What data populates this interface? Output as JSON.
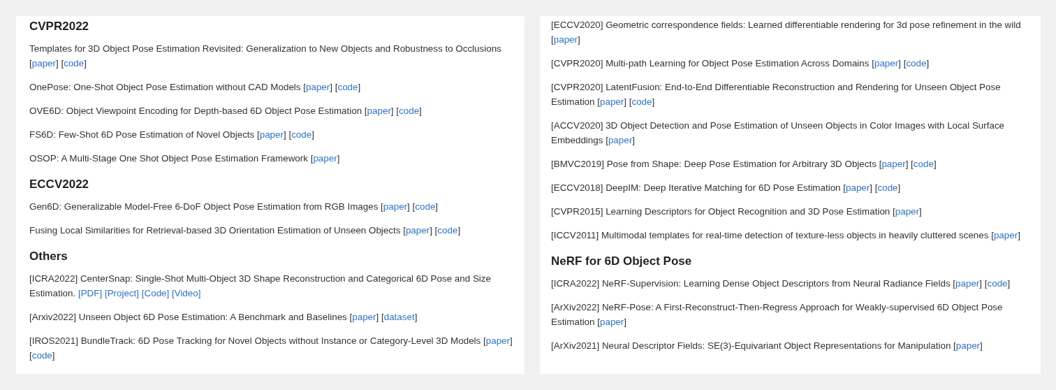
{
  "panels": [
    {
      "blocks": [
        {
          "kind": "heading",
          "text": "CVPR2022"
        },
        {
          "kind": "entry",
          "text": "Templates for 3D Object Pose Estimation Revisited: Generalization to New Objects and Robustness to Occlusions",
          "links": [
            {
              "open": "[",
              "label": "paper",
              "close": "]"
            },
            {
              "open": "[",
              "label": "code",
              "close": "]"
            }
          ]
        },
        {
          "kind": "entry",
          "text": "OnePose: One-Shot Object Pose Estimation without CAD Models",
          "links": [
            {
              "open": "[",
              "label": "paper",
              "close": "]"
            },
            {
              "open": "[",
              "label": "code",
              "close": "]"
            }
          ]
        },
        {
          "kind": "entry",
          "text": "OVE6D: Object Viewpoint Encoding for Depth-based 6D Object Pose Estimation",
          "links": [
            {
              "open": "[",
              "label": "paper",
              "close": "]"
            },
            {
              "open": "[",
              "label": "code",
              "close": "]"
            }
          ]
        },
        {
          "kind": "entry",
          "text": "FS6D: Few-Shot 6D Pose Estimation of Novel Objects",
          "links": [
            {
              "open": "[",
              "label": "paper",
              "close": "]"
            },
            {
              "open": "[",
              "label": "code",
              "close": "]"
            }
          ]
        },
        {
          "kind": "entry",
          "text": "OSOP: A Multi-Stage One Shot Object Pose Estimation Framework",
          "links": [
            {
              "open": "[",
              "label": "paper",
              "close": "]"
            }
          ]
        },
        {
          "kind": "heading",
          "text": "ECCV2022"
        },
        {
          "kind": "entry",
          "text": "Gen6D: Generalizable Model-Free 6-DoF Object Pose Estimation from RGB Images",
          "links": [
            {
              "open": "[",
              "label": "paper",
              "close": "]"
            },
            {
              "open": "[",
              "label": "code",
              "close": "]"
            }
          ]
        },
        {
          "kind": "entry",
          "text": "Fusing Local Similarities for Retrieval-based 3D Orientation Estimation of Unseen Objects",
          "links": [
            {
              "open": "[",
              "label": "paper",
              "close": "]"
            },
            {
              "open": "[",
              "label": "code",
              "close": "]"
            }
          ]
        },
        {
          "kind": "heading",
          "text": "Others"
        },
        {
          "kind": "entry",
          "text": "[ICRA2022] CenterSnap: Single-Shot Multi-Object 3D Shape Reconstruction and Categorical 6D Pose and Size Estimation.",
          "links": [
            {
              "label": "[PDF]"
            },
            {
              "label": "[Project]"
            },
            {
              "label": "[Code]"
            },
            {
              "label": "[Video]"
            }
          ]
        },
        {
          "kind": "entry",
          "text": "[Arxiv2022] Unseen Object 6D Pose Estimation: A Benchmark and Baselines",
          "links": [
            {
              "open": "[",
              "label": "paper",
              "close": "]"
            },
            {
              "open": "[",
              "label": "dataset",
              "close": "]"
            }
          ]
        },
        {
          "kind": "entry",
          "text": "[IROS2021] BundleTrack: 6D Pose Tracking for Novel Objects without Instance or Category-Level 3D Models",
          "links": [
            {
              "open": "[",
              "label": "paper",
              "close": "]"
            },
            {
              "open": "[",
              "label": "code",
              "close": "]"
            }
          ]
        }
      ]
    },
    {
      "blocks": [
        {
          "kind": "entry",
          "text": "[ECCV2020] Geometric correspondence fields: Learned differentiable rendering for 3d pose refinement in the wild",
          "links": [
            {
              "open": "[",
              "label": "paper",
              "close": "]"
            }
          ]
        },
        {
          "kind": "entry",
          "text": "[CVPR2020] Multi-path Learning for Object Pose Estimation Across Domains",
          "links": [
            {
              "open": "[",
              "label": "paper",
              "close": "]"
            },
            {
              "open": "[",
              "label": "code",
              "close": "]"
            }
          ]
        },
        {
          "kind": "entry",
          "text": "[CVPR2020] LatentFusion: End-to-End Differentiable Reconstruction and Rendering for Unseen Object Pose Estimation",
          "links": [
            {
              "open": "[",
              "label": "paper",
              "close": "]"
            },
            {
              "open": "[",
              "label": "code",
              "close": "]"
            }
          ]
        },
        {
          "kind": "entry",
          "text": "[ACCV2020] 3D Object Detection and Pose Estimation of Unseen Objects in Color Images with Local Surface Embeddings",
          "links": [
            {
              "open": "[",
              "label": "paper",
              "close": "]"
            }
          ]
        },
        {
          "kind": "entry",
          "text": "[BMVC2019] Pose from Shape: Deep Pose Estimation for Arbitrary 3D Objects",
          "links": [
            {
              "open": "[",
              "label": "paper",
              "close": "]"
            },
            {
              "open": "[",
              "label": "code",
              "close": "]"
            }
          ]
        },
        {
          "kind": "entry",
          "text": "[ECCV2018] DeepIM: Deep Iterative Matching for 6D Pose Estimation",
          "links": [
            {
              "open": "[",
              "label": "paper",
              "close": "]"
            },
            {
              "open": "[",
              "label": "code",
              "close": "]"
            }
          ]
        },
        {
          "kind": "entry",
          "text": "[CVPR2015] Learning Descriptors for Object Recognition and 3D Pose Estimation",
          "links": [
            {
              "open": "[",
              "label": "paper",
              "close": "]"
            }
          ]
        },
        {
          "kind": "entry",
          "text": "[ICCV2011] Multimodal templates for real-time detection of texture-less objects in heavily cluttered scenes",
          "links": [
            {
              "open": "[",
              "label": "paper",
              "close": "]"
            }
          ]
        },
        {
          "kind": "heading",
          "text": "NeRF for 6D Object Pose"
        },
        {
          "kind": "entry",
          "text": "[ICRA2022] NeRF-Supervision: Learning Dense Object Descriptors from Neural Radiance Fields",
          "links": [
            {
              "open": "[",
              "label": "paper",
              "close": "]"
            },
            {
              "open": "[",
              "label": "code",
              "close": "]"
            }
          ]
        },
        {
          "kind": "entry",
          "text": "[ArXiv2022] NeRF-Pose: A First-Reconstruct-Then-Regress Approach for Weakly-supervised 6D Object Pose Estimation",
          "links": [
            {
              "open": "[",
              "label": "paper",
              "close": "]"
            }
          ]
        },
        {
          "kind": "entry",
          "text": "[ArXiv2021] Neural Descriptor Fields: SE(3)-Equivariant Object Representations for Manipulation",
          "links": [
            {
              "open": "[",
              "label": "paper",
              "close": "]"
            }
          ]
        }
      ]
    }
  ]
}
